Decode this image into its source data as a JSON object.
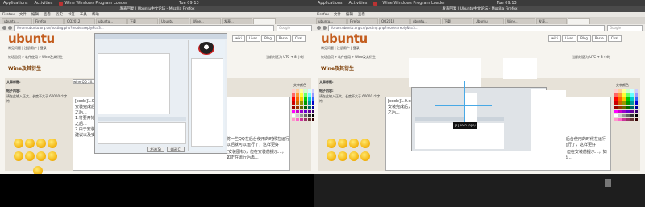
{
  "top_panel": {
    "menu_applications": "Applications",
    "menu_activities": "Activities",
    "window_title": "Wine Windows Program Loader",
    "clock": "Tue 09:13"
  },
  "browser": {
    "title": "发表回复 | Ubuntu中文论坛 - Mozilla Firefox",
    "menu": [
      "Firefox",
      "文件",
      "编辑",
      "查看",
      "历史",
      "书签",
      "工具",
      "帮助"
    ],
    "tabs": [
      "ubuntu...",
      "Firefox",
      "QQ2012",
      "ubuntu...",
      "下载",
      "Ubuntu",
      "Wine...",
      "发表..."
    ],
    "url": "forum.ubuntu.org.cn/posting.php?mode=reply&t=3...",
    "search_placeholder": "Google"
  },
  "forum": {
    "logo": "ubuntu",
    "nav": [
      "wiki",
      "Lives",
      "Blog",
      "Paste",
      "Chat"
    ],
    "header_links": "常见问题  |  注册用户  |  登录",
    "breadcrumb": "论坛首页 » 软件使用 » Wine及其衍生",
    "sub_breadcrumb": "当前时区为 UTC + 8 小时",
    "topic_title": "Wine及其衍生",
    "reply_label": "文章标题:",
    "reply_subject": "wine QQ 20...",
    "body_label": "帖子内容:",
    "body_help": "请在此输入正文，长度不大于 60000 个字符",
    "smilies_label": "表情",
    "font_color_label": "文字颜色",
    "body_text_lines": [
      "[code]1.0.se...",
      "安装完成后，可运行...",
      "之后...",
      "1.将要开始安装中文中",
      "之后...",
      "2.由于安装了 中文 则...",
      "建议以及安装..."
    ],
    "right_text_1": "将一些QQ在后台使用的时候在运行以后就可以运行了，这样更好",
    "right_text_2": "(安装图标)，但在安装前提示...，如正在运行后再..."
  },
  "qq_dialog": {
    "title": "",
    "send_button": "发送(S)",
    "close_button": "关闭(C)"
  },
  "second_screen": {
    "tooltip": "[1] 2062 [0] 0/1",
    "send_button": "发送(S)",
    "close_button": "关闭(C)"
  },
  "colors": {
    "ubuntu_orange": "#c35c1d",
    "panel_dark": "#3b3b3b",
    "page_bg": "#f6f4ef"
  }
}
